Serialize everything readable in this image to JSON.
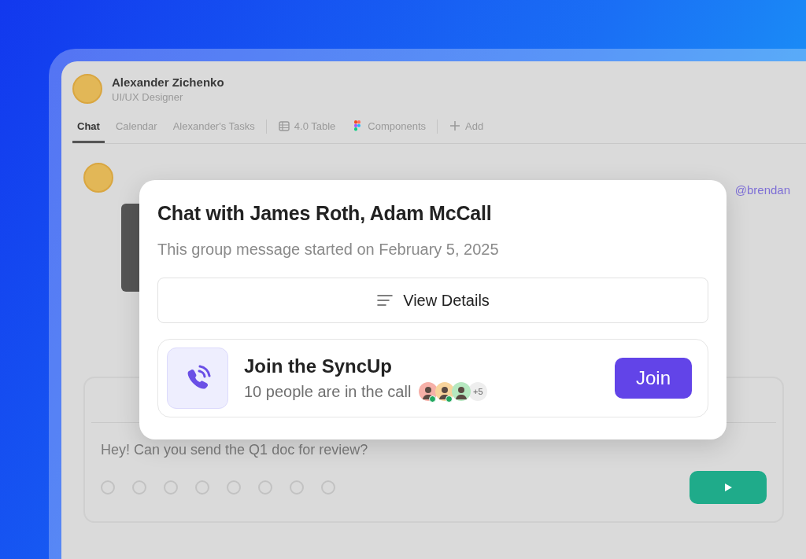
{
  "profile": {
    "name": "Alexander Zichenko",
    "role": "UI/UX Designer"
  },
  "tabs": [
    {
      "label": "Chat",
      "selected": true
    },
    {
      "label": "Calendar",
      "selected": false
    },
    {
      "label": "Alexander's Tasks",
      "selected": false
    }
  ],
  "views": [
    {
      "label": "4.0 Table",
      "kind": "table"
    },
    {
      "label": "Components",
      "kind": "design"
    }
  ],
  "add_button": "Add",
  "message": {
    "mention": "@brendan"
  },
  "composer": {
    "value": "Hey! Can you send the Q1 doc for review?"
  },
  "dialog": {
    "title": "Chat with James Roth, Adam McCall",
    "subtitle": "This group message started on February 5, 2025",
    "details_button": "View Details",
    "call": {
      "title": "Join the SyncUp",
      "subtitle": "10 people are in the call",
      "participants": [
        {
          "color": "#f6b0a8",
          "online": true
        },
        {
          "color": "#f8d49c",
          "online": true
        },
        {
          "color": "#b6e8c0",
          "online": false
        }
      ],
      "more": "+5",
      "join_button": "Join"
    }
  }
}
